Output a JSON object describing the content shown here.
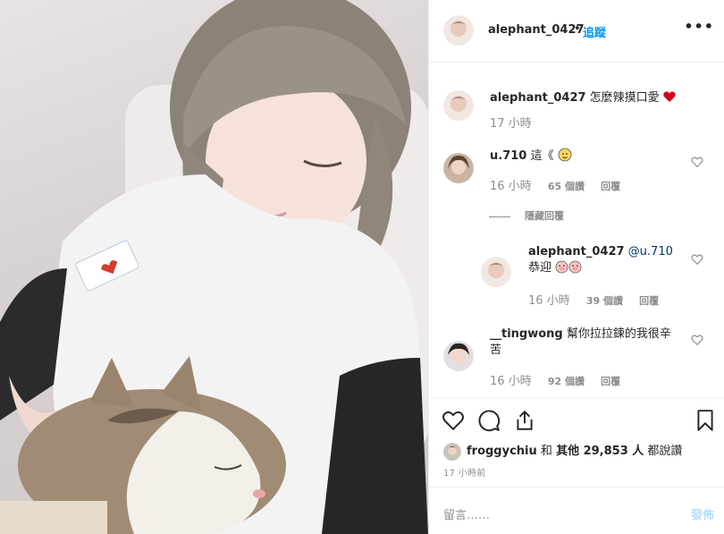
{
  "post": {
    "username": "alephant_0427",
    "separator": "•",
    "follow_label": "追蹤",
    "more_icon": "more-options-icon",
    "caption": {
      "username": "alephant_0427",
      "text": "怎麼辣摸口愛",
      "time": "17 小時"
    }
  },
  "comments": [
    {
      "username": "u.710",
      "text": "這《",
      "time": "16 小時",
      "likes": "65 個讚",
      "reply_label": "回覆"
    },
    {
      "username": "__tingwong",
      "text": "幫你拉拉鍊的我很辛苦",
      "time": "16 小時",
      "likes": "92 個讚",
      "reply_label": "回覆"
    }
  ],
  "view_replies_label": "隱藏回覆",
  "reply": {
    "username": "alephant_0427",
    "mention": "@u.710",
    "text": "恭迎",
    "time": "16 小時",
    "likes": "39 個讚",
    "reply_label": "回覆"
  },
  "likes_line": {
    "liker": "froggychiu",
    "and": "和",
    "others": "其他 29,853 人",
    "suffix": "都說讚"
  },
  "post_time": "17 小時前",
  "add_comment": {
    "placeholder": "留言……",
    "post_label": "發佈"
  },
  "colors": {
    "link": "#0095f6",
    "heart": "#ed4956",
    "muted": "#8e8e8e"
  }
}
